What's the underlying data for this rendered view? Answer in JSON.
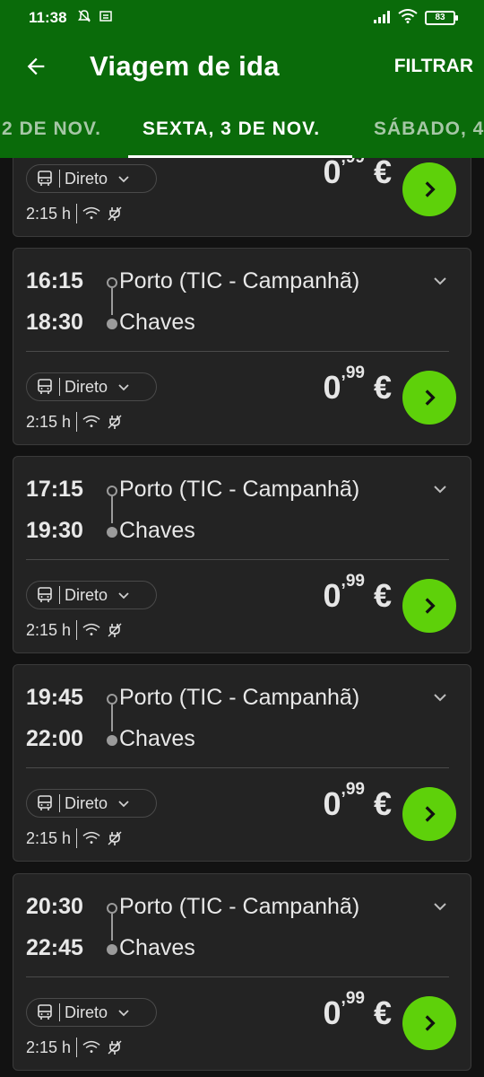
{
  "status_bar": {
    "time": "11:38",
    "battery": "83",
    "icons": [
      "bell-off-icon",
      "notification-icon",
      "signal-icon",
      "wifi-icon",
      "battery-icon"
    ]
  },
  "app_bar": {
    "title": "Viagem de ida",
    "filter_label": "FILTRAR",
    "back_icon": "arrow-left-icon"
  },
  "tabs": [
    {
      "label": "2 DE NOV."
    },
    {
      "label": "SEXTA, 3 DE NOV.",
      "active": true
    },
    {
      "label": "SÁBADO, 4"
    }
  ],
  "colors": {
    "header": "#0a6b0a",
    "background": "#121212",
    "card": "#232323",
    "accent": "#5ed10a"
  },
  "trips": [
    {
      "departure": "",
      "arrival": "",
      "origin": "",
      "destination": "",
      "type": "Direto",
      "duration": "2:15 h",
      "price_int": "0",
      "price_dec": "99",
      "currency": "€"
    },
    {
      "departure": "16:15",
      "arrival": "18:30",
      "origin": "Porto (TIC - Campanhã)",
      "destination": "Chaves",
      "type": "Direto",
      "duration": "2:15 h",
      "price_int": "0",
      "price_dec": "99",
      "currency": "€"
    },
    {
      "departure": "17:15",
      "arrival": "19:30",
      "origin": "Porto (TIC - Campanhã)",
      "destination": "Chaves",
      "type": "Direto",
      "duration": "2:15 h",
      "price_int": "0",
      "price_dec": "99",
      "currency": "€"
    },
    {
      "departure": "19:45",
      "arrival": "22:00",
      "origin": "Porto (TIC - Campanhã)",
      "destination": "Chaves",
      "type": "Direto",
      "duration": "2:15 h",
      "price_int": "0",
      "price_dec": "99",
      "currency": "€"
    },
    {
      "departure": "20:30",
      "arrival": "22:45",
      "origin": "Porto (TIC - Campanhã)",
      "destination": "Chaves",
      "type": "Direto",
      "duration": "2:15 h",
      "price_int": "0",
      "price_dec": "99",
      "currency": "€"
    }
  ]
}
